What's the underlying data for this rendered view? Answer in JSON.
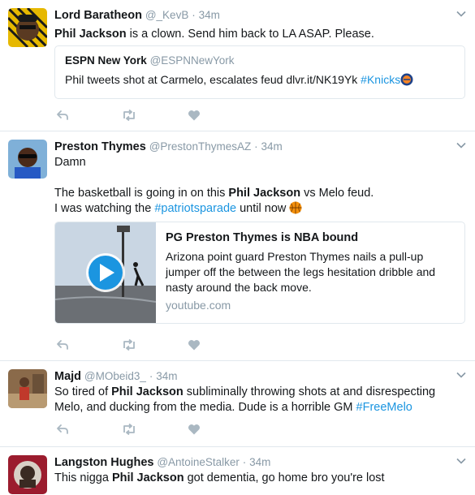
{
  "colors": {
    "accent": "#1b95e0",
    "muted": "#8899a6",
    "text": "#14171a",
    "border": "#e1e8ed"
  },
  "tweets": [
    {
      "name": "Lord Baratheon",
      "handle": "@_KevB",
      "sep": "·",
      "time": "34m",
      "text_parts": [
        "",
        "Phil Jackson",
        " is a clown. Send him back to LA ASAP. Please."
      ],
      "quote": {
        "name": "ESPN New York",
        "handle": "@ESPNNewYork",
        "text": "Phil tweets shot at Carmelo, escalates feud dlvr.it/NK19Yk ",
        "hashtag": "#Knicks",
        "emoji": "knicks-logo-icon"
      }
    },
    {
      "name": "Preston Thymes",
      "handle": "@PrestonThymesAZ",
      "sep": "·",
      "time": "34m",
      "line1": "Damn",
      "line2_parts": [
        "The basketball is going in on this ",
        "Phil Jackson",
        " vs Melo feud."
      ],
      "line3_parts": [
        "I was watching the ",
        "#patriotsparade",
        " until now "
      ],
      "emoji": "basketball-icon",
      "card": {
        "title": "PG Preston Thymes is NBA bound",
        "description": "Arizona point guard Preston Thymes nails a pull-up jumper off the between the legs hesitation dribble and nasty around the back move.",
        "domain": "youtube.com"
      }
    },
    {
      "name": "Majd",
      "handle": "@MObeid3_",
      "sep": "·",
      "time": "34m",
      "text_parts": [
        "So tired of ",
        "Phil Jackson",
        " subliminally throwing shots at and disrespecting Melo, and ducking from the media. Dude is a horrible GM "
      ],
      "hashtag": "#FreeMelo"
    },
    {
      "name": "Langston Hughes",
      "handle": "@AntoineStalker",
      "sep": "·",
      "time": "34m",
      "text_parts": [
        "This nigga ",
        "Phil Jackson",
        " got dementia, go home bro you're lost"
      ]
    }
  ]
}
